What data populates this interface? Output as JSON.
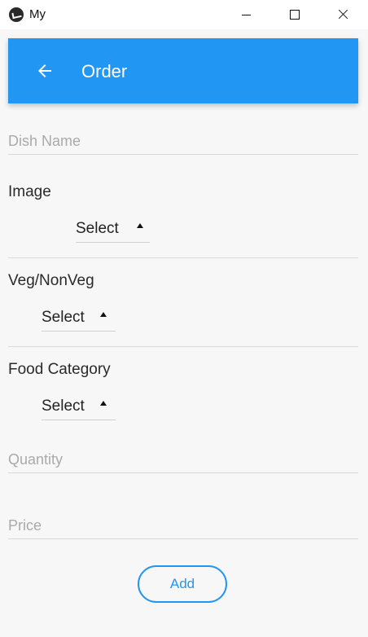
{
  "window": {
    "title": "My"
  },
  "appbar": {
    "title": "Order"
  },
  "form": {
    "dish_name": {
      "placeholder": "Dish Name",
      "value": ""
    },
    "image": {
      "label": "Image",
      "selected": "Select"
    },
    "veg_nonveg": {
      "label": "Veg/NonVeg",
      "selected": "Select"
    },
    "food_category": {
      "label": "Food Category",
      "selected": "Select"
    },
    "quantity": {
      "placeholder": "Quantity",
      "value": ""
    },
    "price": {
      "placeholder": "Price",
      "value": ""
    },
    "add_label": "Add"
  },
  "colors": {
    "primary": "#2196f3",
    "background": "#f7f7f7"
  }
}
